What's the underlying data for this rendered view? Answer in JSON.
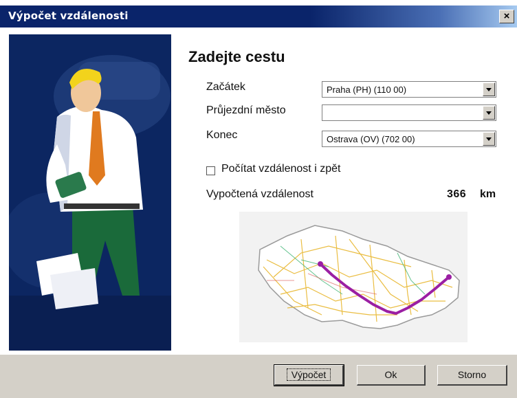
{
  "window": {
    "title": "Výpočet vzdálenosti",
    "close_label": "×"
  },
  "route": {
    "heading": "Zadejte cestu",
    "start_label": "Začátek",
    "start_value": "Praha  (PH) (110 00)",
    "via_label": "Průjezdní město",
    "via_value": "",
    "end_label": "Konec",
    "end_value": "Ostrava  (OV) (702 00)",
    "return_label": "Počítat vzdálenost i zpět",
    "return_checked": false,
    "distance_label": "Vypočtená vzdálenost",
    "distance_value": "366",
    "distance_unit": "km"
  },
  "buttons": {
    "calculate": "Výpočet",
    "ok": "Ok",
    "cancel": "Storno"
  },
  "icons": {
    "close": "close-icon",
    "dropdown": "chevron-down-icon"
  },
  "colors": {
    "titlebar": "#0a246a",
    "panel": "#0c2661",
    "route": "#9b1fa3",
    "roads": "#e8b62d"
  }
}
